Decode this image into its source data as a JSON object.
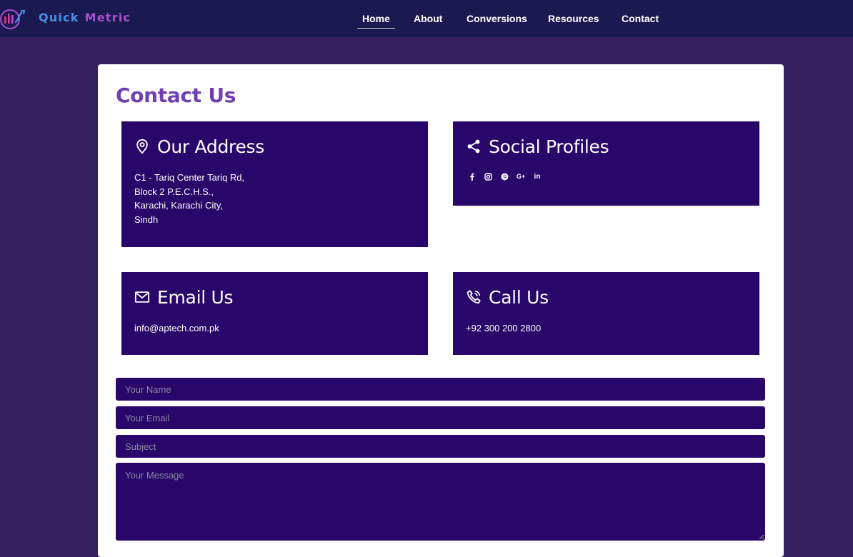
{
  "brand": {
    "word1": "Quick",
    "word2": "Metric"
  },
  "nav": {
    "items": [
      {
        "label": "Home",
        "active": true
      },
      {
        "label": "About"
      },
      {
        "label": "Conversions"
      },
      {
        "label": "Resources"
      },
      {
        "label": "Contact"
      }
    ]
  },
  "page": {
    "title": "Contact Us"
  },
  "address": {
    "title": "Our Address",
    "icon": "map-pin-icon",
    "lines": [
      "C1 - Tariq Center Tariq Rd,",
      "Block 2 P.E.C.H.S.,",
      "Karachi, Karachi City,",
      "Sindh"
    ]
  },
  "social": {
    "title": "Social Profiles",
    "icon": "share-icon",
    "links": [
      "facebook-icon",
      "instagram-icon",
      "pinterest-icon",
      "google-plus-icon",
      "linkedin-icon"
    ]
  },
  "email": {
    "title": "Email Us",
    "icon": "envelope-icon",
    "value": "info@aptech.com.pk"
  },
  "phone": {
    "title": "Call Us",
    "icon": "phone-icon",
    "value": "+92 300 200 2800"
  },
  "form": {
    "name_placeholder": "Your Name",
    "email_placeholder": "Your Email",
    "subject_placeholder": "Subject",
    "message_placeholder": "Your Message"
  },
  "colors": {
    "page_bg": "#34205e",
    "nav_bg": "#1b1a50",
    "box_bg": "#29066a",
    "title_purple": "#7040b0",
    "logo_blue": "#4a8fe6",
    "logo_purple": "#a94fd0"
  }
}
